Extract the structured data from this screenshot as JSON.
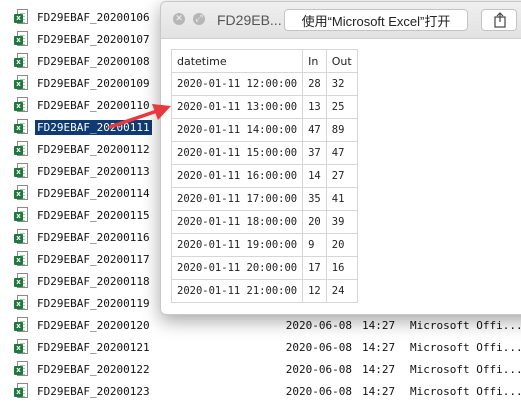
{
  "files": [
    {
      "name": "FD29EBAF_20200106",
      "date": "",
      "time": "",
      "kind": ""
    },
    {
      "name": "FD29EBAF_20200107",
      "date": "",
      "time": "",
      "kind": ""
    },
    {
      "name": "FD29EBAF_20200108",
      "date": "",
      "time": "",
      "kind": ""
    },
    {
      "name": "FD29EBAF_20200109",
      "date": "",
      "time": "",
      "kind": ""
    },
    {
      "name": "FD29EBAF_20200110",
      "date": "",
      "time": "",
      "kind": ""
    },
    {
      "name": "FD29EBAF_20200111",
      "date": "",
      "time": "",
      "kind": "",
      "selected": true
    },
    {
      "name": "FD29EBAF_20200112",
      "date": "",
      "time": "",
      "kind": ""
    },
    {
      "name": "FD29EBAF_20200113",
      "date": "",
      "time": "",
      "kind": ""
    },
    {
      "name": "FD29EBAF_20200114",
      "date": "",
      "time": "",
      "kind": ""
    },
    {
      "name": "FD29EBAF_20200115",
      "date": "",
      "time": "",
      "kind": ""
    },
    {
      "name": "FD29EBAF_20200116",
      "date": "",
      "time": "",
      "kind": ""
    },
    {
      "name": "FD29EBAF_20200117",
      "date": "",
      "time": "",
      "kind": ""
    },
    {
      "name": "FD29EBAF_20200118",
      "date": "",
      "time": "",
      "kind": ""
    },
    {
      "name": "FD29EBAF_20200119",
      "date": "",
      "time": "",
      "kind": ""
    },
    {
      "name": "FD29EBAF_20200120",
      "date": "2020-06-08",
      "time": "14:27",
      "kind": "Microsoft Offi..."
    },
    {
      "name": "FD29EBAF_20200121",
      "date": "2020-06-08",
      "time": "14:27",
      "kind": "Microsoft Offi..."
    },
    {
      "name": "FD29EBAF_20200122",
      "date": "2020-06-08",
      "time": "14:27",
      "kind": "Microsoft Offi..."
    },
    {
      "name": "FD29EBAF_20200123",
      "date": "2020-06-08",
      "time": "14:27",
      "kind": "Microsoft Offi..."
    }
  ],
  "quicklook": {
    "title": "FD29EB...",
    "open_with_label": "使用“Microsoft Excel”打开",
    "share_icon": "share-icon",
    "columns": [
      "datetime",
      "In",
      "Out"
    ],
    "rows": [
      [
        "2020-01-11 12:00:00",
        "28",
        "32"
      ],
      [
        "2020-01-11 13:00:00",
        "13",
        "25"
      ],
      [
        "2020-01-11 14:00:00",
        "47",
        "89"
      ],
      [
        "2020-01-11 15:00:00",
        "37",
        "47"
      ],
      [
        "2020-01-11 16:00:00",
        "14",
        "27"
      ],
      [
        "2020-01-11 17:00:00",
        "35",
        "41"
      ],
      [
        "2020-01-11 18:00:00",
        "20",
        "39"
      ],
      [
        "2020-01-11 19:00:00",
        "9",
        "20"
      ],
      [
        "2020-01-11 20:00:00",
        "17",
        "16"
      ],
      [
        "2020-01-11 21:00:00",
        "12",
        "24"
      ]
    ]
  },
  "colors": {
    "selection": "#0f3a73",
    "arrow": "#e8393d",
    "excel_green": "#1d7a3c"
  }
}
